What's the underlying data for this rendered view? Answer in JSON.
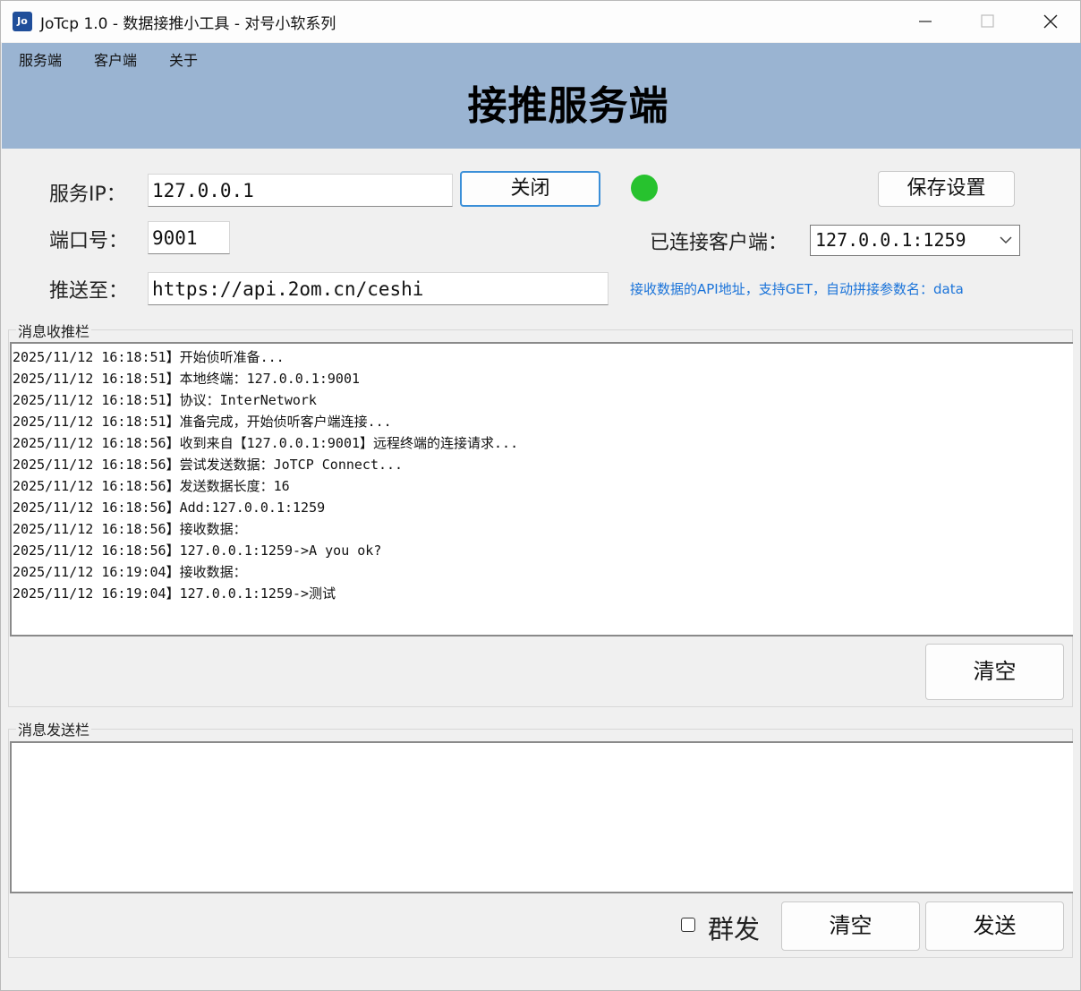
{
  "window": {
    "title": "JoTcp 1.0 - 数据接推小工具 - 对号小软系列",
    "icon_text": "Jo"
  },
  "menu": {
    "items": [
      "服务端",
      "客户端",
      "关于"
    ]
  },
  "header": {
    "title": "接推服务端"
  },
  "form": {
    "ip_label": "服务IP：",
    "ip_value": "127.0.0.1",
    "close_button": "关闭",
    "status_color": "#27c22e",
    "save_button": "保存设置",
    "port_label": "端口号：",
    "port_value": "9001",
    "client_label": "已连接客户端：",
    "client_selected": "127.0.0.1:1259",
    "push_label": "推送至：",
    "push_value": "https://api.2om.cn/ceshi",
    "push_hint": "接收数据的API地址，支持GET，自动拼接参数名：data"
  },
  "receive_panel": {
    "title": "消息收推栏",
    "clear_button": "清空",
    "log": [
      "2025/11/12 16:18:51】开始侦听准备...",
      "2025/11/12 16:18:51】本地终端：127.0.0.1:9001",
      "2025/11/12 16:18:51】协议：InterNetwork",
      "2025/11/12 16:18:51】准备完成，开始侦听客户端连接...",
      "2025/11/12 16:18:56】收到来自【127.0.0.1:9001】远程终端的连接请求...",
      "2025/11/12 16:18:56】尝试发送数据：JoTCP Connect...",
      "2025/11/12 16:18:56】发送数据长度：16",
      "2025/11/12 16:18:56】Add:127.0.0.1:1259",
      "2025/11/12 16:18:56】接收数据：",
      "2025/11/12 16:18:56】127.0.0.1:1259->A you ok?",
      "2025/11/12 16:19:04】接收数据：",
      "2025/11/12 16:19:04】127.0.0.1:1259->测试"
    ]
  },
  "send_panel": {
    "title": "消息发送栏",
    "message_value": "",
    "broadcast_label": "群发",
    "clear_button": "清空",
    "send_button": "发送"
  }
}
